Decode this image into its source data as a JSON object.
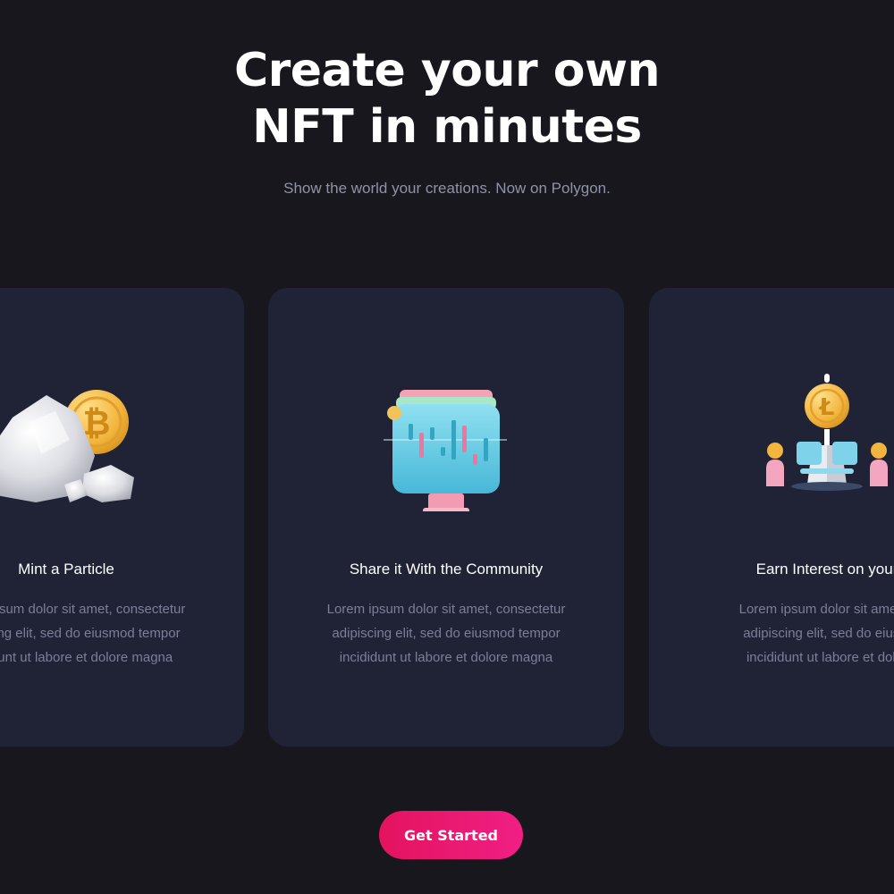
{
  "hero": {
    "title_line1": "Create your own",
    "title_line2": "NFT in minutes",
    "subtitle": "Show the world your creations. Now on Polygon."
  },
  "cards": [
    {
      "title": "Mint a Particle",
      "body_lines": [
        "Lorem ipsum dolor sit amet, consectetur",
        "adipiscing elit, sed do eiusmod tempor",
        "incididunt ut labore et dolore magna"
      ],
      "icon": "bitcoin-rock-icon"
    },
    {
      "title": "Share it With the Community",
      "body_lines": [
        "Lorem ipsum dolor sit amet, consectetur",
        "adipiscing elit, sed do eiusmod tempor",
        "incididunt ut labore et dolore magna"
      ],
      "icon": "trading-monitor-icon"
    },
    {
      "title": "Earn Interest on your",
      "body_lines": [
        "Lorem ipsum dolor sit amet, c",
        "adipiscing elit, sed do eiusm",
        "incididunt ut labore et dolor"
      ],
      "icon": "litecoin-staking-icon"
    }
  ],
  "cta": {
    "label": "Get Started"
  },
  "colors": {
    "background": "#17171d",
    "card": "#202236",
    "accent": "#e4135f",
    "muted_text": "#7b7f97"
  }
}
